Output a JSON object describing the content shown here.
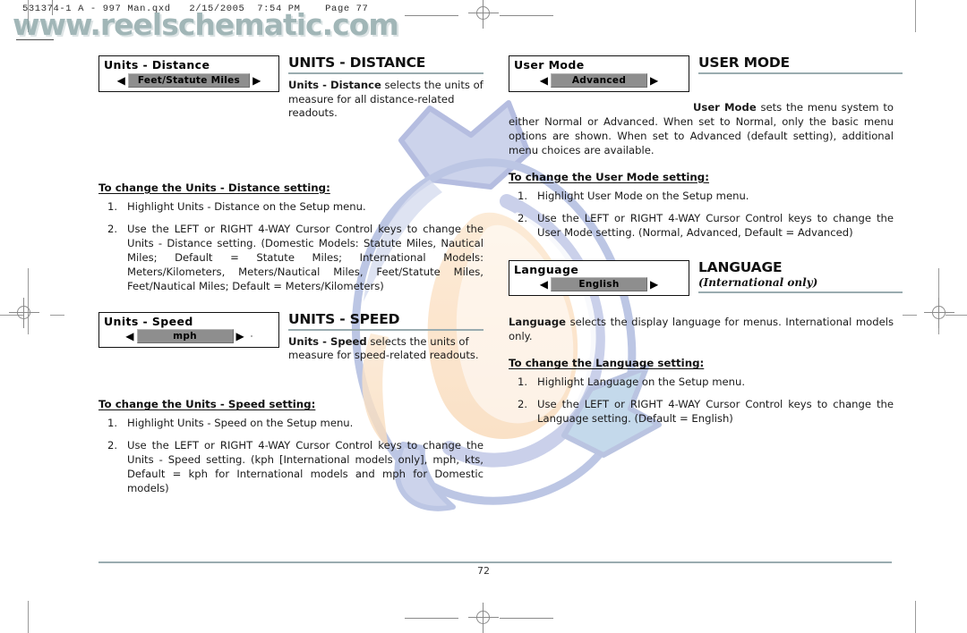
{
  "prepress": {
    "slug_pre": "531374-1 A - 997 Man",
    "slug_post": "qxd   2/15/2005",
    "slug_time": "7:54 PM    Page 77",
    "slug_full": "531374-1 A - 997 Man.qxd   2/15/2005  7:54 PM    Page 77"
  },
  "watermark": {
    "wordmark": "www.reelschematic.com"
  },
  "footer": {
    "page_number": "72"
  },
  "sections": [
    {
      "id": "units-distance",
      "menu": {
        "title": "Units - Distance",
        "value": "Feet/Statute Miles",
        "left_arrow": "◀",
        "right_arrow": "▶"
      },
      "heading": "UNITS - DISTANCE",
      "subheading": "",
      "intro_bold": "Units - Distance",
      "intro_rest": " selects the units of measure for all distance-related readouts.",
      "howto": "To change the Units - Distance setting:",
      "steps": [
        {
          "num": "1.",
          "text": "Highlight Units - Distance on the Setup menu."
        },
        {
          "num": "2.",
          "text": "Use the LEFT or RIGHT 4-WAY Cursor Control keys to change the Units - Distance setting. (Domestic Models: Statute Miles, Nautical Miles; Default = Statute Miles; International Models: Meters/Kilometers, Meters/Nautical Miles, Feet/Statute Miles, Feet/Nautical Miles; Default = Meters/Kilometers)"
        }
      ]
    },
    {
      "id": "units-speed",
      "menu": {
        "title": "Units - Speed",
        "value": "mph",
        "left_arrow": "◀",
        "right_arrow": "▶"
      },
      "heading": "UNITS - SPEED",
      "subheading": "",
      "intro_bold": "Units - Speed",
      "intro_rest": " selects the units of measure for speed-related readouts.",
      "howto": "To change the Units - Speed setting:",
      "steps": [
        {
          "num": "1.",
          "text": "Highlight Units - Speed on the Setup menu."
        },
        {
          "num": "2.",
          "text": "Use the LEFT or RIGHT 4-WAY Cursor Control keys to change the Units - Speed setting. (kph [International models only], mph, kts, Default = kph for International models and mph for Domestic models)"
        }
      ]
    },
    {
      "id": "user-mode",
      "menu": {
        "title": "User Mode",
        "value": "Advanced",
        "left_arrow": "◀",
        "right_arrow": "▶"
      },
      "heading": "USER MODE",
      "subheading": "",
      "intro_bold": "User Mode",
      "intro_rest": " sets the menu system to either Normal or Advanced. When set to Normal, only the basic menu options are shown. When set to Advanced (default setting), additional menu choices are available.",
      "howto": "To change the User Mode setting:",
      "steps": [
        {
          "num": "1.",
          "text": "Highlight User Mode on the Setup menu."
        },
        {
          "num": "2.",
          "text": "Use the LEFT or RIGHT 4-WAY Cursor Control keys to change the User Mode setting. (Normal, Advanced, Default = Advanced)"
        }
      ]
    },
    {
      "id": "language",
      "menu": {
        "title": "Language",
        "value": "English",
        "left_arrow": "◀",
        "right_arrow": "▶"
      },
      "heading": "LANGUAGE",
      "subheading": "(International only)",
      "intro_bold": "Language",
      "intro_rest": " selects the display language for menus. International models only.",
      "howto": "To change the Language setting:",
      "steps": [
        {
          "num": "1.",
          "text": "Highlight Language on the Setup menu."
        },
        {
          "num": "2.",
          "text": "Use the LEFT or RIGHT 4-WAY Cursor Control keys to change the Language setting. (Default = English)"
        }
      ]
    }
  ],
  "colors": {
    "rule": "#9aacb0",
    "menu_value_bg": "#8e8e8e",
    "wordmark": "#7d9a9c",
    "watermark_blue": "#b9c2e2",
    "watermark_peach": "#fae0c6"
  }
}
